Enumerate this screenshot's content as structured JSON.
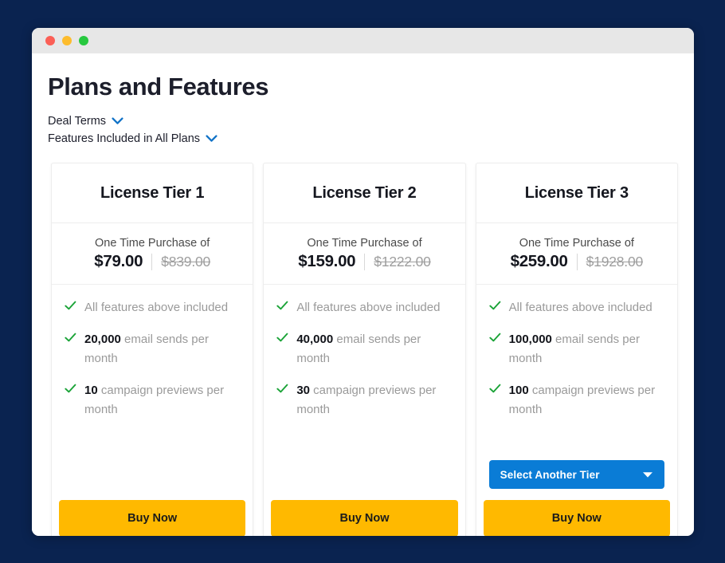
{
  "window": {
    "traffic_lights": [
      {
        "name": "close-button",
        "color": "#fb5f56"
      },
      {
        "name": "minimize-button",
        "color": "#fdbc2d"
      },
      {
        "name": "maximize-button",
        "color": "#27c83f"
      }
    ]
  },
  "header": {
    "title": "Plans and Features",
    "disclosures": [
      {
        "label": "Deal Terms",
        "icon": "chevron-down-icon"
      },
      {
        "label": "Features Included in All Plans",
        "icon": "chevron-down-icon"
      }
    ]
  },
  "colors": {
    "page_background": "#0a2350",
    "titlebar": "#e7e7e7",
    "accent_blue": "#0a7cd6",
    "buy_yellow": "#ffb900",
    "check_green": "#1aa337",
    "muted_text": "#9a9a9a"
  },
  "plans": [
    {
      "title": "License Tier 1",
      "price_label": "One Time Purchase of",
      "price": "$79.00",
      "price_original": "$839.00",
      "features": [
        {
          "emphasis": "",
          "text": "All features above included"
        },
        {
          "emphasis": "20,000",
          "text": " email sends per month"
        },
        {
          "emphasis": "10",
          "text": " campaign previews per month"
        }
      ],
      "has_tier_select": false,
      "tier_select_label": "",
      "buy_label": "Buy Now"
    },
    {
      "title": "License Tier 2",
      "price_label": "One Time Purchase of",
      "price": "$159.00",
      "price_original": "$1222.00",
      "features": [
        {
          "emphasis": "",
          "text": "All features above included"
        },
        {
          "emphasis": "40,000",
          "text": " email sends per month"
        },
        {
          "emphasis": "30",
          "text": " campaign previews per month"
        }
      ],
      "has_tier_select": false,
      "tier_select_label": "",
      "buy_label": "Buy Now"
    },
    {
      "title": "License Tier 3",
      "price_label": "One Time Purchase of",
      "price": "$259.00",
      "price_original": "$1928.00",
      "features": [
        {
          "emphasis": "",
          "text": "All features above included"
        },
        {
          "emphasis": "100,000",
          "text": " email sends per month"
        },
        {
          "emphasis": "100",
          "text": " campaign previews per month"
        }
      ],
      "has_tier_select": true,
      "tier_select_label": "Select Another Tier",
      "buy_label": "Buy Now"
    }
  ]
}
